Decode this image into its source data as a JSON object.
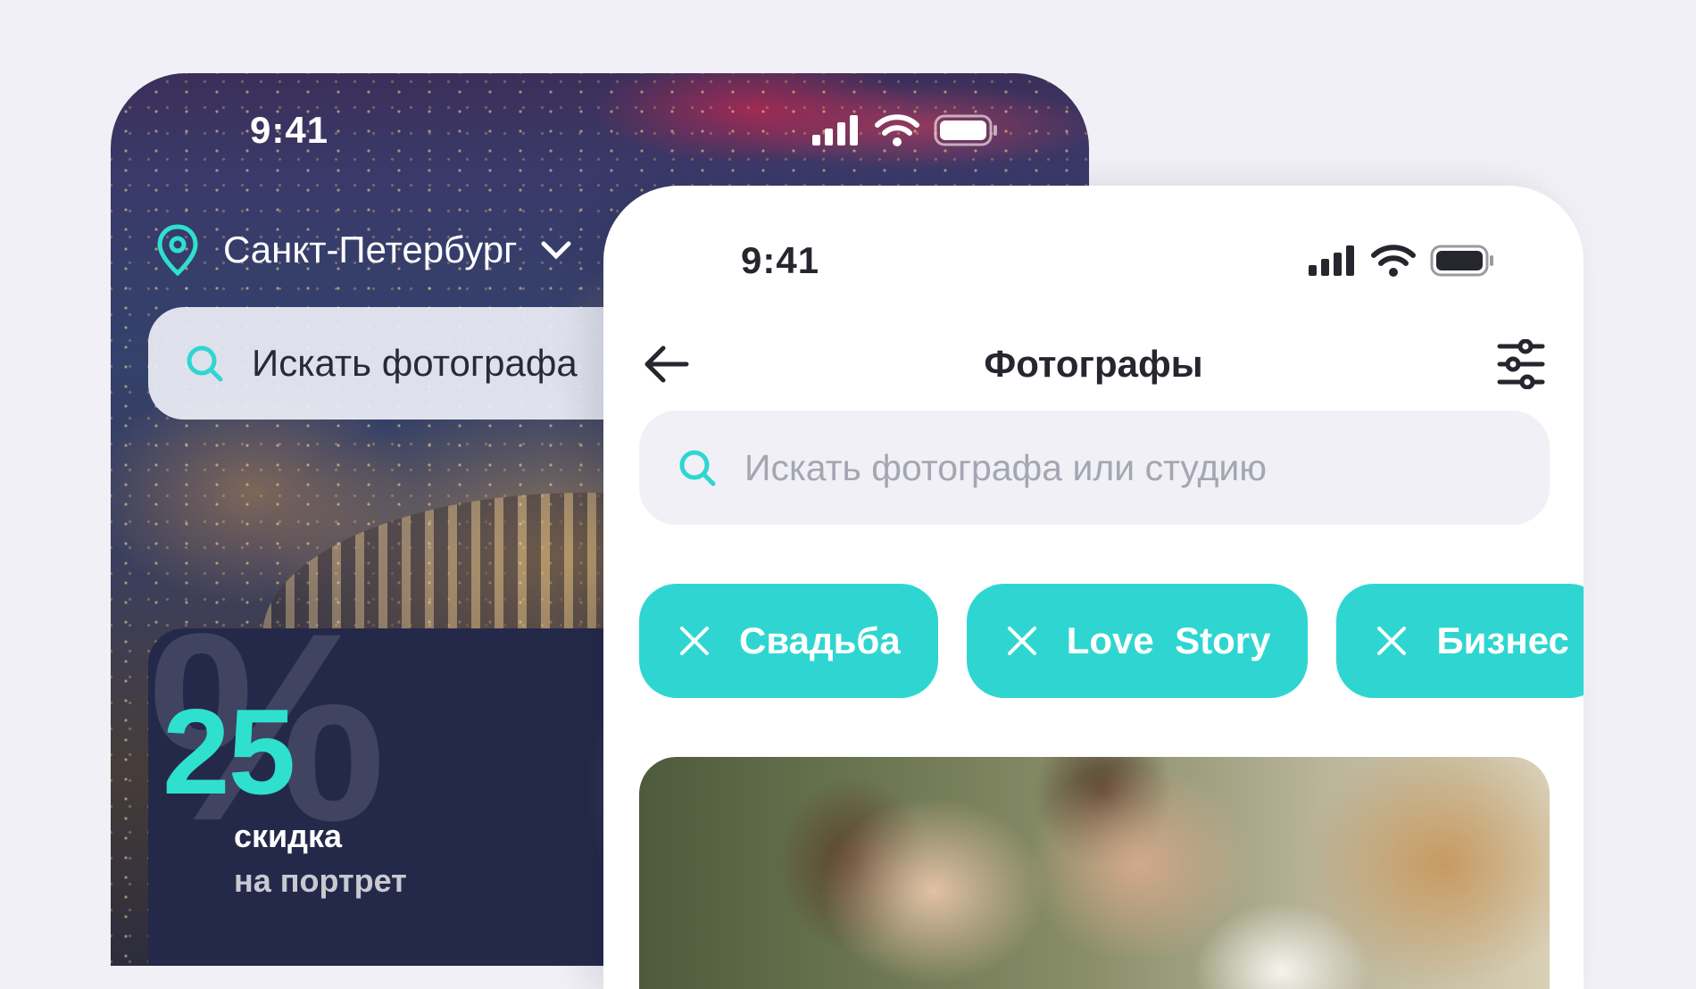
{
  "back_phone": {
    "status": {
      "time": "9:41"
    },
    "location": {
      "city": "Санкт-Петербург"
    },
    "search": {
      "placeholder": "Искать фотографа"
    },
    "promo": {
      "symbol": "%",
      "number": "25",
      "label": "скидка",
      "sublabel": "на портрет"
    }
  },
  "front_phone": {
    "status": {
      "time": "9:41"
    },
    "nav": {
      "title": "Фотографы"
    },
    "search": {
      "placeholder": "Искать фотографа или студию"
    },
    "chips": [
      {
        "label": "Свадьба"
      },
      {
        "label": "Love  Story"
      },
      {
        "label": "Бизнес"
      }
    ]
  },
  "colors": {
    "accent": "#2fd6d1",
    "accent_text": "#2fe0cf",
    "promo_bg": "#24294a",
    "search_bg": "#f0f0f6"
  }
}
